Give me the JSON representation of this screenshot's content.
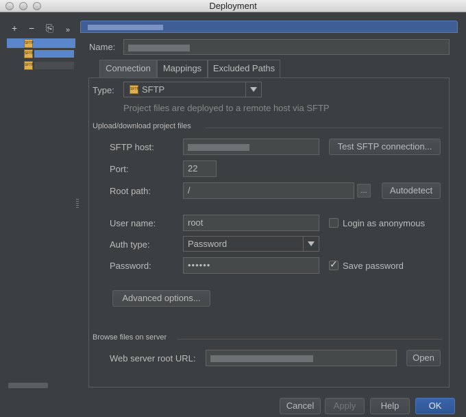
{
  "window": {
    "title": "Deployment"
  },
  "toolbar": {
    "add": "+",
    "remove": "−",
    "copy": "⎘",
    "more": "»"
  },
  "name": {
    "label": "Name:"
  },
  "tabs": [
    {
      "label": "Connection",
      "active": true
    },
    {
      "label": "Mappings",
      "active": false
    },
    {
      "label": "Excluded Paths",
      "active": false
    }
  ],
  "type": {
    "label": "Type:",
    "value": "SFTP",
    "description": "Project files are deployed to a remote host via SFTP"
  },
  "upload": {
    "section_title": "Upload/download project files",
    "sftp_host_label": "SFTP host:",
    "test_button": "Test SFTP connection...",
    "port_label": "Port:",
    "port_value": "22",
    "root_path_label": "Root path:",
    "root_path_value": "/",
    "browse_button": "...",
    "autodetect_button": "Autodetect",
    "user_name_label": "User name:",
    "user_name_value": "root",
    "anonymous_label": "Login as anonymous",
    "anonymous_checked": false,
    "auth_type_label": "Auth type:",
    "auth_type_value": "Password",
    "password_label": "Password:",
    "password_value": "••••••",
    "save_password_label": "Save password",
    "save_password_checked": true,
    "advanced_button": "Advanced options..."
  },
  "browse": {
    "section_title": "Browse files on server",
    "web_root_label": "Web server root URL:",
    "open_button": "Open"
  },
  "footer": {
    "cancel": "Cancel",
    "apply": "Apply",
    "help": "Help",
    "ok": "OK"
  },
  "colors": {
    "background": "#3c3f41",
    "accent": "#305694",
    "selection": "#5a86cc"
  }
}
